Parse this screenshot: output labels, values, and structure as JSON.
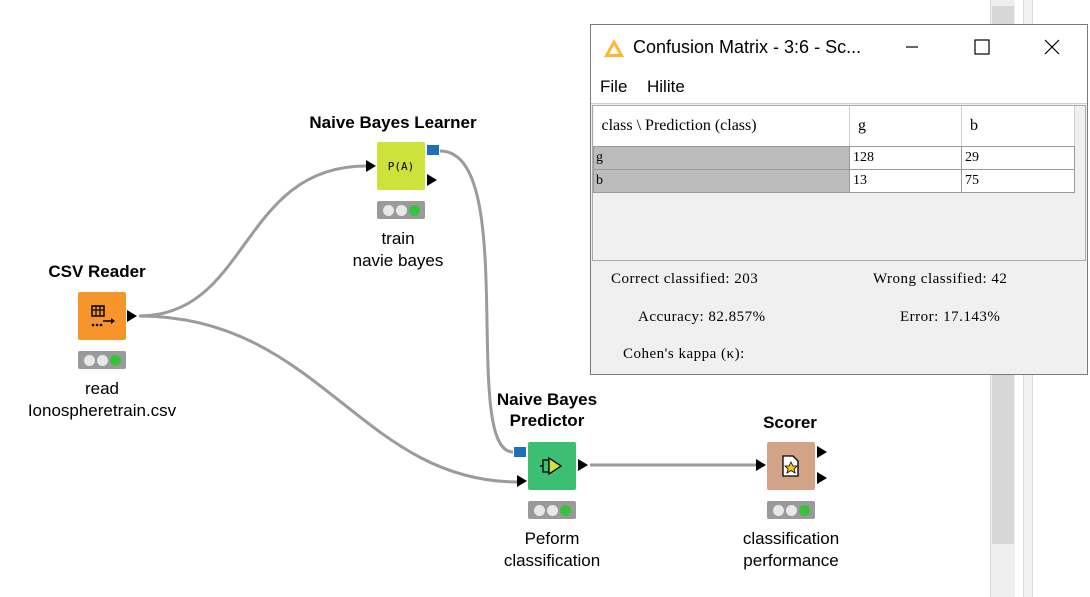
{
  "nodes": {
    "csv_reader": {
      "title": "CSV Reader",
      "label": "read\nIonospheretrain.csv",
      "color": "#f7952d",
      "status": [
        "off",
        "off",
        "green"
      ]
    },
    "nb_learner": {
      "title": "Naive Bayes Learner",
      "label": "train\nnavie bayes",
      "icon_text": "P(A)",
      "color": "#cde23a",
      "status": [
        "off",
        "off",
        "green"
      ]
    },
    "nb_predictor": {
      "title": "Naive Bayes\nPredictor",
      "label": "Peform\nclassification",
      "color": "#3cbf73",
      "status": [
        "off",
        "off",
        "green"
      ]
    },
    "scorer": {
      "title": "Scorer",
      "label": "classification\nperformance",
      "color": "#d2a386",
      "status": [
        "off",
        "off",
        "green"
      ]
    }
  },
  "confusion_window": {
    "title": "Confusion Matrix - 3:6 - Sc...",
    "menu": [
      "File",
      "Hilite"
    ],
    "columns": [
      "class \\ Prediction (class)",
      "g",
      "b"
    ],
    "rows": [
      {
        "label": "g",
        "values": [
          "128",
          "29"
        ]
      },
      {
        "label": "b",
        "values": [
          "13",
          "75"
        ]
      }
    ],
    "stats": {
      "correct": "Correct classified: 203",
      "wrong": "Wrong classified: 42",
      "accuracy": "Accuracy: 82.857%",
      "error": "Error: 17.143%",
      "kappa": "Cohen's kappa (κ):"
    }
  },
  "colors": {
    "connection": "#9b9b9b",
    "port_blue": "#1f6fb8"
  }
}
